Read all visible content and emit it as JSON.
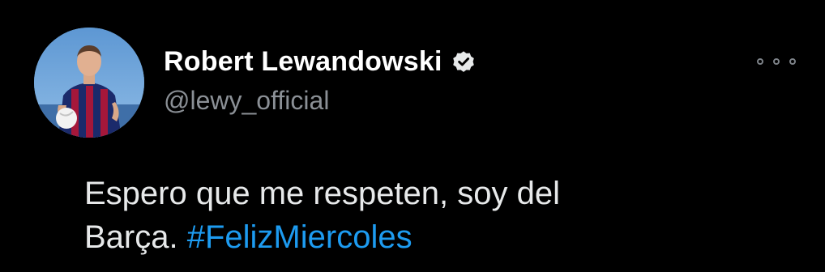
{
  "author": {
    "name": "Robert Lewandowski",
    "handle": "@lewy_official",
    "verified": true
  },
  "tweet": {
    "line1": "Espero que me respeten, soy del",
    "line2_text": "Barça.",
    "hashtag": "#FelizMiercoles"
  },
  "icons": {
    "verified": "verified-badge-icon",
    "more": "more-options-icon"
  },
  "colors": {
    "background": "#000000",
    "text": "#e7e9ea",
    "handle": "#8b9096",
    "hashtag": "#1d9bf0"
  }
}
